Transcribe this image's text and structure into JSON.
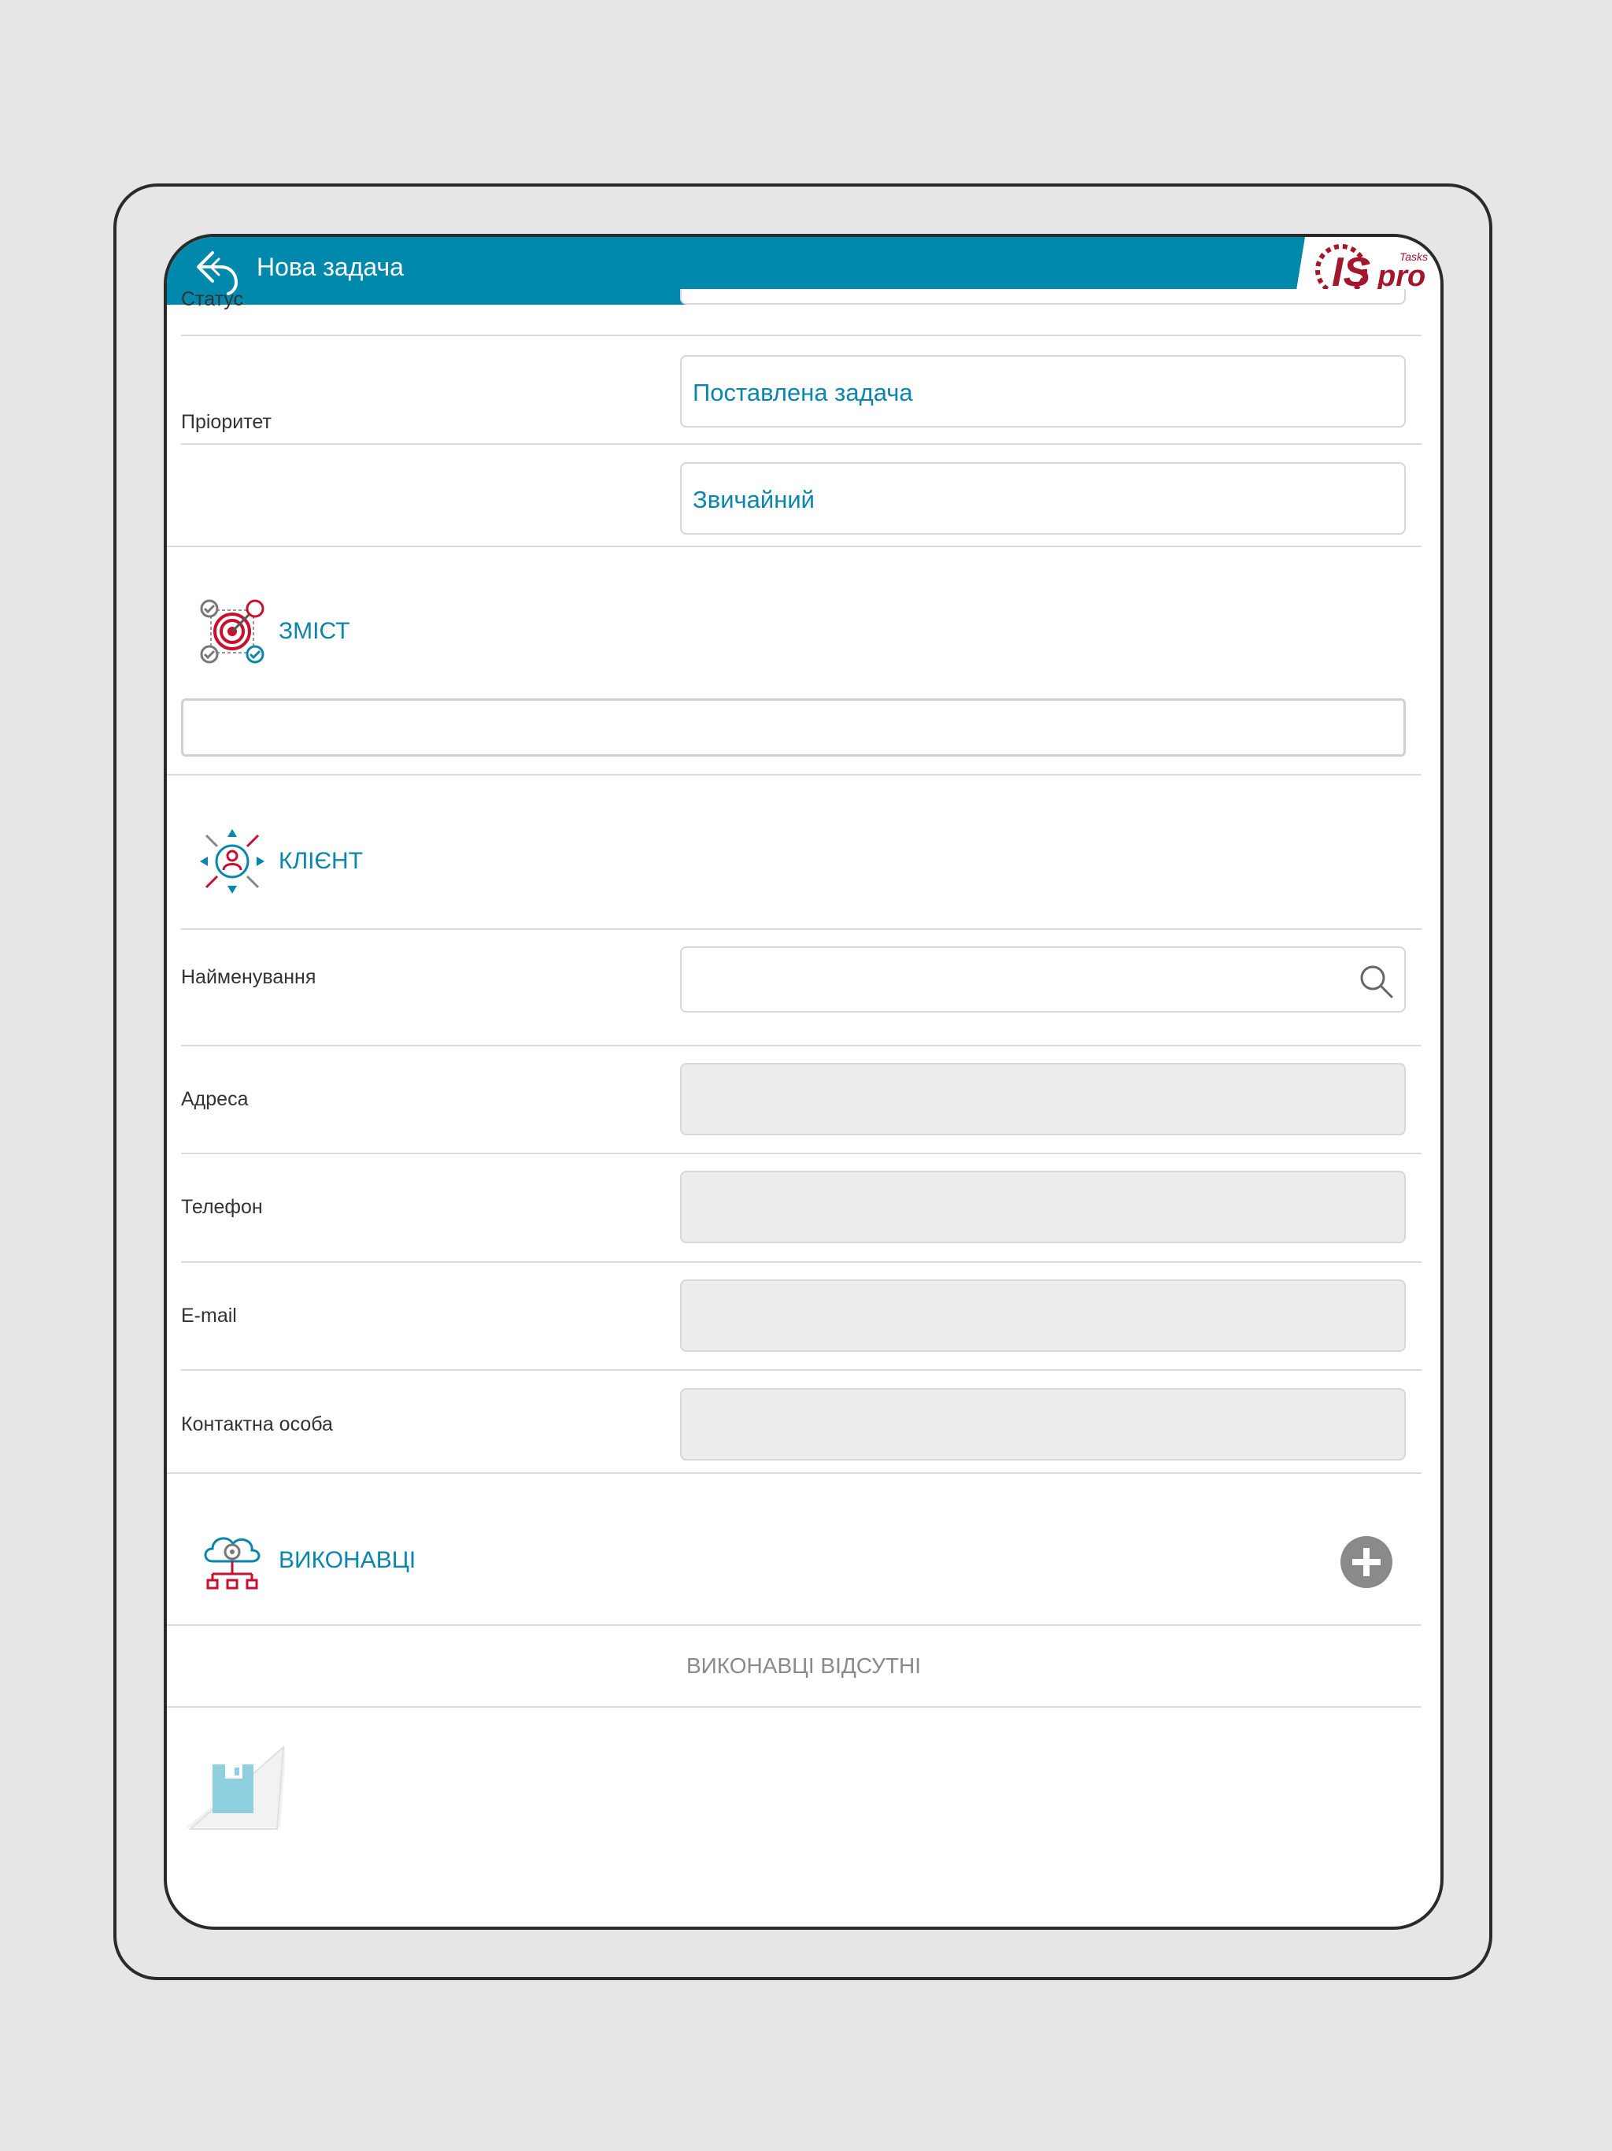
{
  "header": {
    "title": "Нова задача",
    "back_icon": "back-arrow-icon",
    "logo": {
      "brand": "ISpro",
      "product": "Tasks",
      "color": "#a3162b"
    }
  },
  "form": {
    "status": {
      "label": "Статус",
      "value": "Поставлена задача"
    },
    "priority": {
      "label": "Пріоритет",
      "value": "Звичайний"
    }
  },
  "content_section": {
    "title": "ЗМІСТ",
    "icon": "target-icon",
    "value": ""
  },
  "client_section": {
    "title": "КЛІЄНТ",
    "icon": "client-arrows-icon",
    "fields": {
      "name": {
        "label": "Найменування",
        "value": ""
      },
      "address": {
        "label": "Адреса",
        "value": ""
      },
      "phone": {
        "label": "Телефон",
        "value": ""
      },
      "email": {
        "label": "E-mail",
        "value": ""
      },
      "contact": {
        "label": "Контактна особа",
        "value": ""
      }
    }
  },
  "executors_section": {
    "title": "ВИКОНАВЦІ",
    "icon": "cloud-network-icon",
    "empty_message": "ВИКОНАВЦІ ВІДСУТНІ"
  },
  "colors": {
    "header": "#0088ad",
    "accent": "#0a86ad",
    "logo_red": "#a3162b",
    "save_icon": "#8ecfe0"
  }
}
